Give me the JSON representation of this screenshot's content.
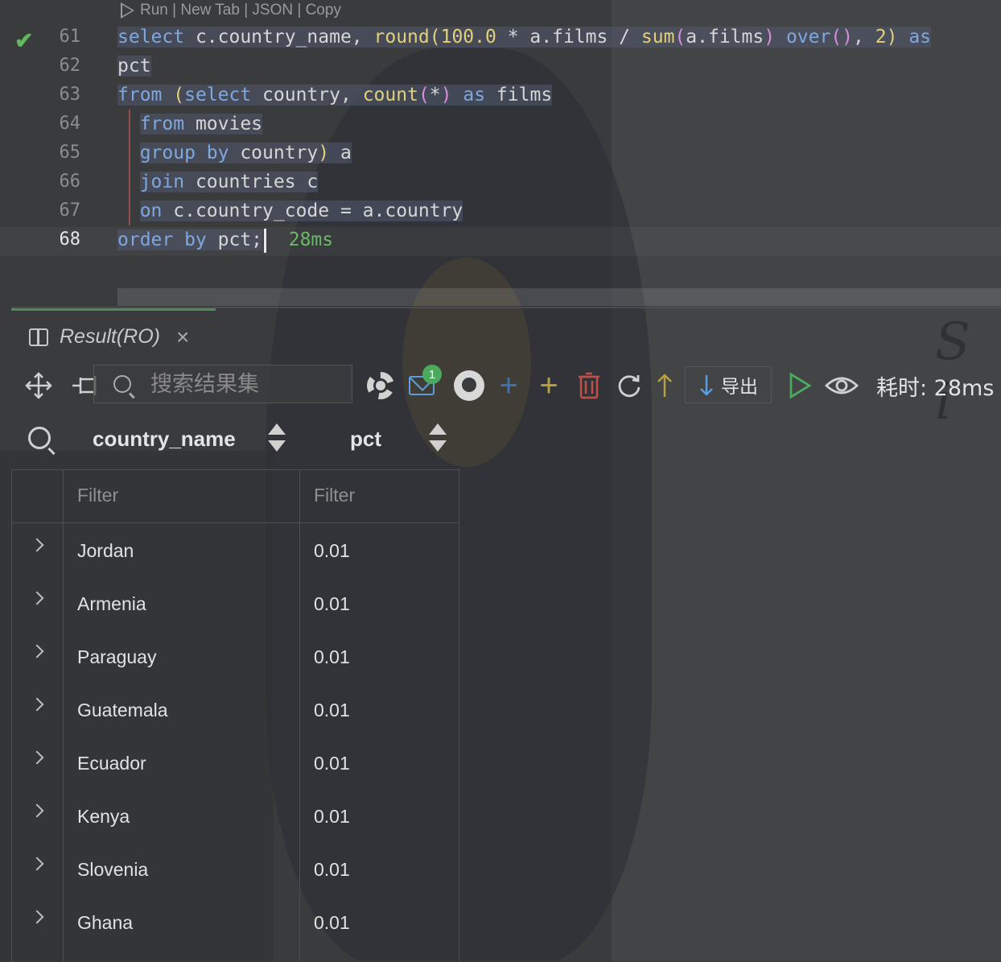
{
  "editor": {
    "codelens": "Run | New Tab | JSON | Copy",
    "line_numbers": [
      "61",
      "62",
      "63",
      "64",
      "65",
      "66",
      "67",
      "68"
    ],
    "current_line": "68",
    "execution_time": "28ms"
  },
  "result_panel": {
    "tab_title": "Result(RO)",
    "search_placeholder": "搜索结果集",
    "notification_count": "1",
    "export_label": "导出",
    "time_label": "耗时: 28ms",
    "columns": [
      "country_name",
      "pct"
    ],
    "filter_placeholder": "Filter",
    "rows": [
      {
        "country_name": "Jordan",
        "pct": "0.01"
      },
      {
        "country_name": "Armenia",
        "pct": "0.01"
      },
      {
        "country_name": "Paraguay",
        "pct": "0.01"
      },
      {
        "country_name": "Guatemala",
        "pct": "0.01"
      },
      {
        "country_name": "Ecuador",
        "pct": "0.01"
      },
      {
        "country_name": "Kenya",
        "pct": "0.01"
      },
      {
        "country_name": "Slovenia",
        "pct": "0.01"
      },
      {
        "country_name": "Ghana",
        "pct": "0.01"
      }
    ]
  },
  "colors": {
    "keyword": "#7fa7e0",
    "function": "#e2d07b",
    "success": "#5fb85a",
    "accent_blue": "#5a9ee0",
    "delete_red": "#c0504a",
    "add_yellow": "#b8a040"
  }
}
